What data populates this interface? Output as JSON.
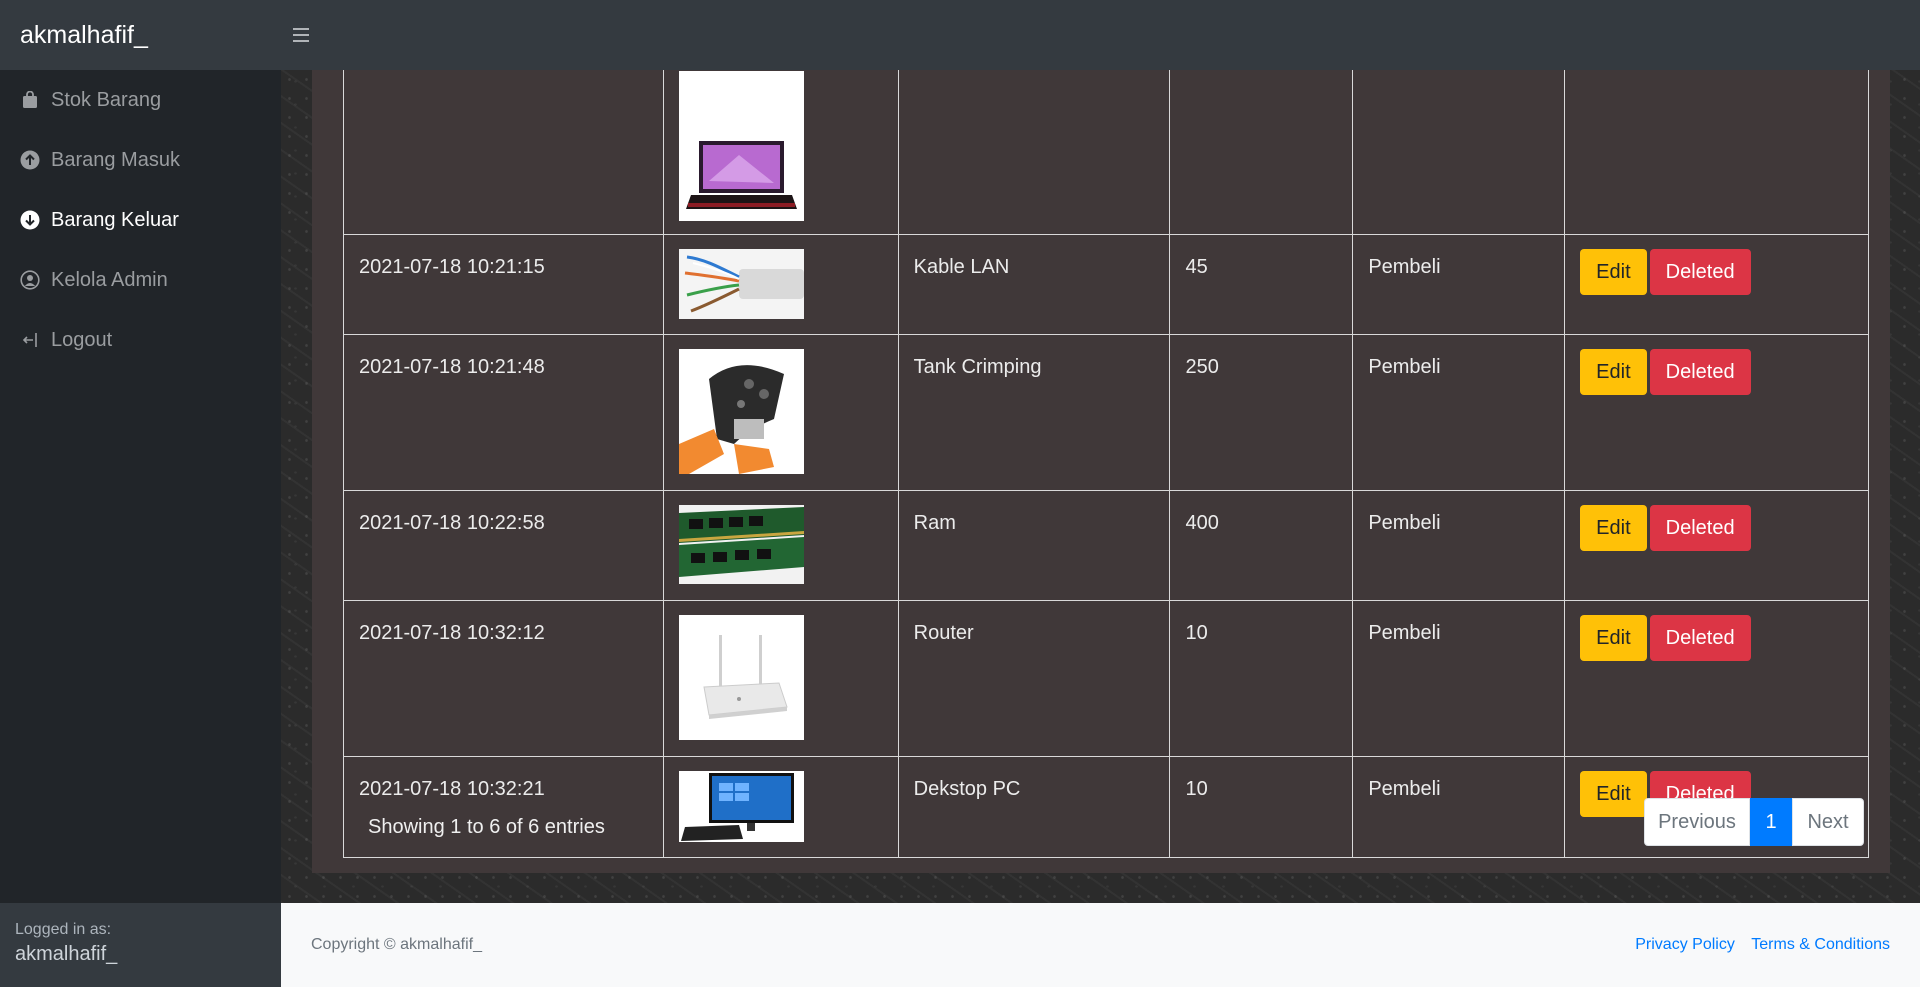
{
  "app": {
    "brand": "akmalhafif_"
  },
  "sidebar": {
    "items": [
      {
        "label": "Stok Barang",
        "icon": "shopping-bag-icon"
      },
      {
        "label": "Barang Masuk",
        "icon": "arrow-circle-up-icon"
      },
      {
        "label": "Barang Keluar",
        "icon": "arrow-circle-down-icon",
        "active": true
      },
      {
        "label": "Kelola Admin",
        "icon": "user-circle-icon"
      },
      {
        "label": "Logout",
        "icon": "sign-out-icon"
      }
    ],
    "logged_label": "Logged in as:",
    "logged_user": "akmalhafif_"
  },
  "table": {
    "rows": [
      {
        "date": "",
        "image": "laptop",
        "name": "",
        "qty": "",
        "buyer": ""
      },
      {
        "date": "2021-07-18 10:21:15",
        "image": "lan-cable",
        "name": "Kable LAN",
        "qty": "45",
        "buyer": "Pembeli"
      },
      {
        "date": "2021-07-18 10:21:48",
        "image": "crimping-tool",
        "name": "Tank Crimping",
        "qty": "250",
        "buyer": "Pembeli"
      },
      {
        "date": "2021-07-18 10:22:58",
        "image": "ram-module",
        "name": "Ram",
        "qty": "400",
        "buyer": "Pembeli"
      },
      {
        "date": "2021-07-18 10:32:12",
        "image": "router",
        "name": "Router",
        "qty": "10",
        "buyer": "Pembeli"
      },
      {
        "date": "2021-07-18 10:32:21",
        "image": "desktop-pc",
        "name": "Dekstop PC",
        "qty": "10",
        "buyer": "Pembeli"
      }
    ],
    "edit_label": "Edit",
    "delete_label": "Deleted"
  },
  "pagination": {
    "info": "Showing 1 to 6 of 6 entries",
    "previous": "Previous",
    "current": "1",
    "next": "Next"
  },
  "footer": {
    "copyright": "Copyright © akmalhafif_",
    "privacy": "Privacy Policy",
    "terms": "Terms & Conditions"
  },
  "colors": {
    "edit": "#ffc107",
    "delete": "#dc3545",
    "primary": "#007bff",
    "card": "#403839"
  }
}
